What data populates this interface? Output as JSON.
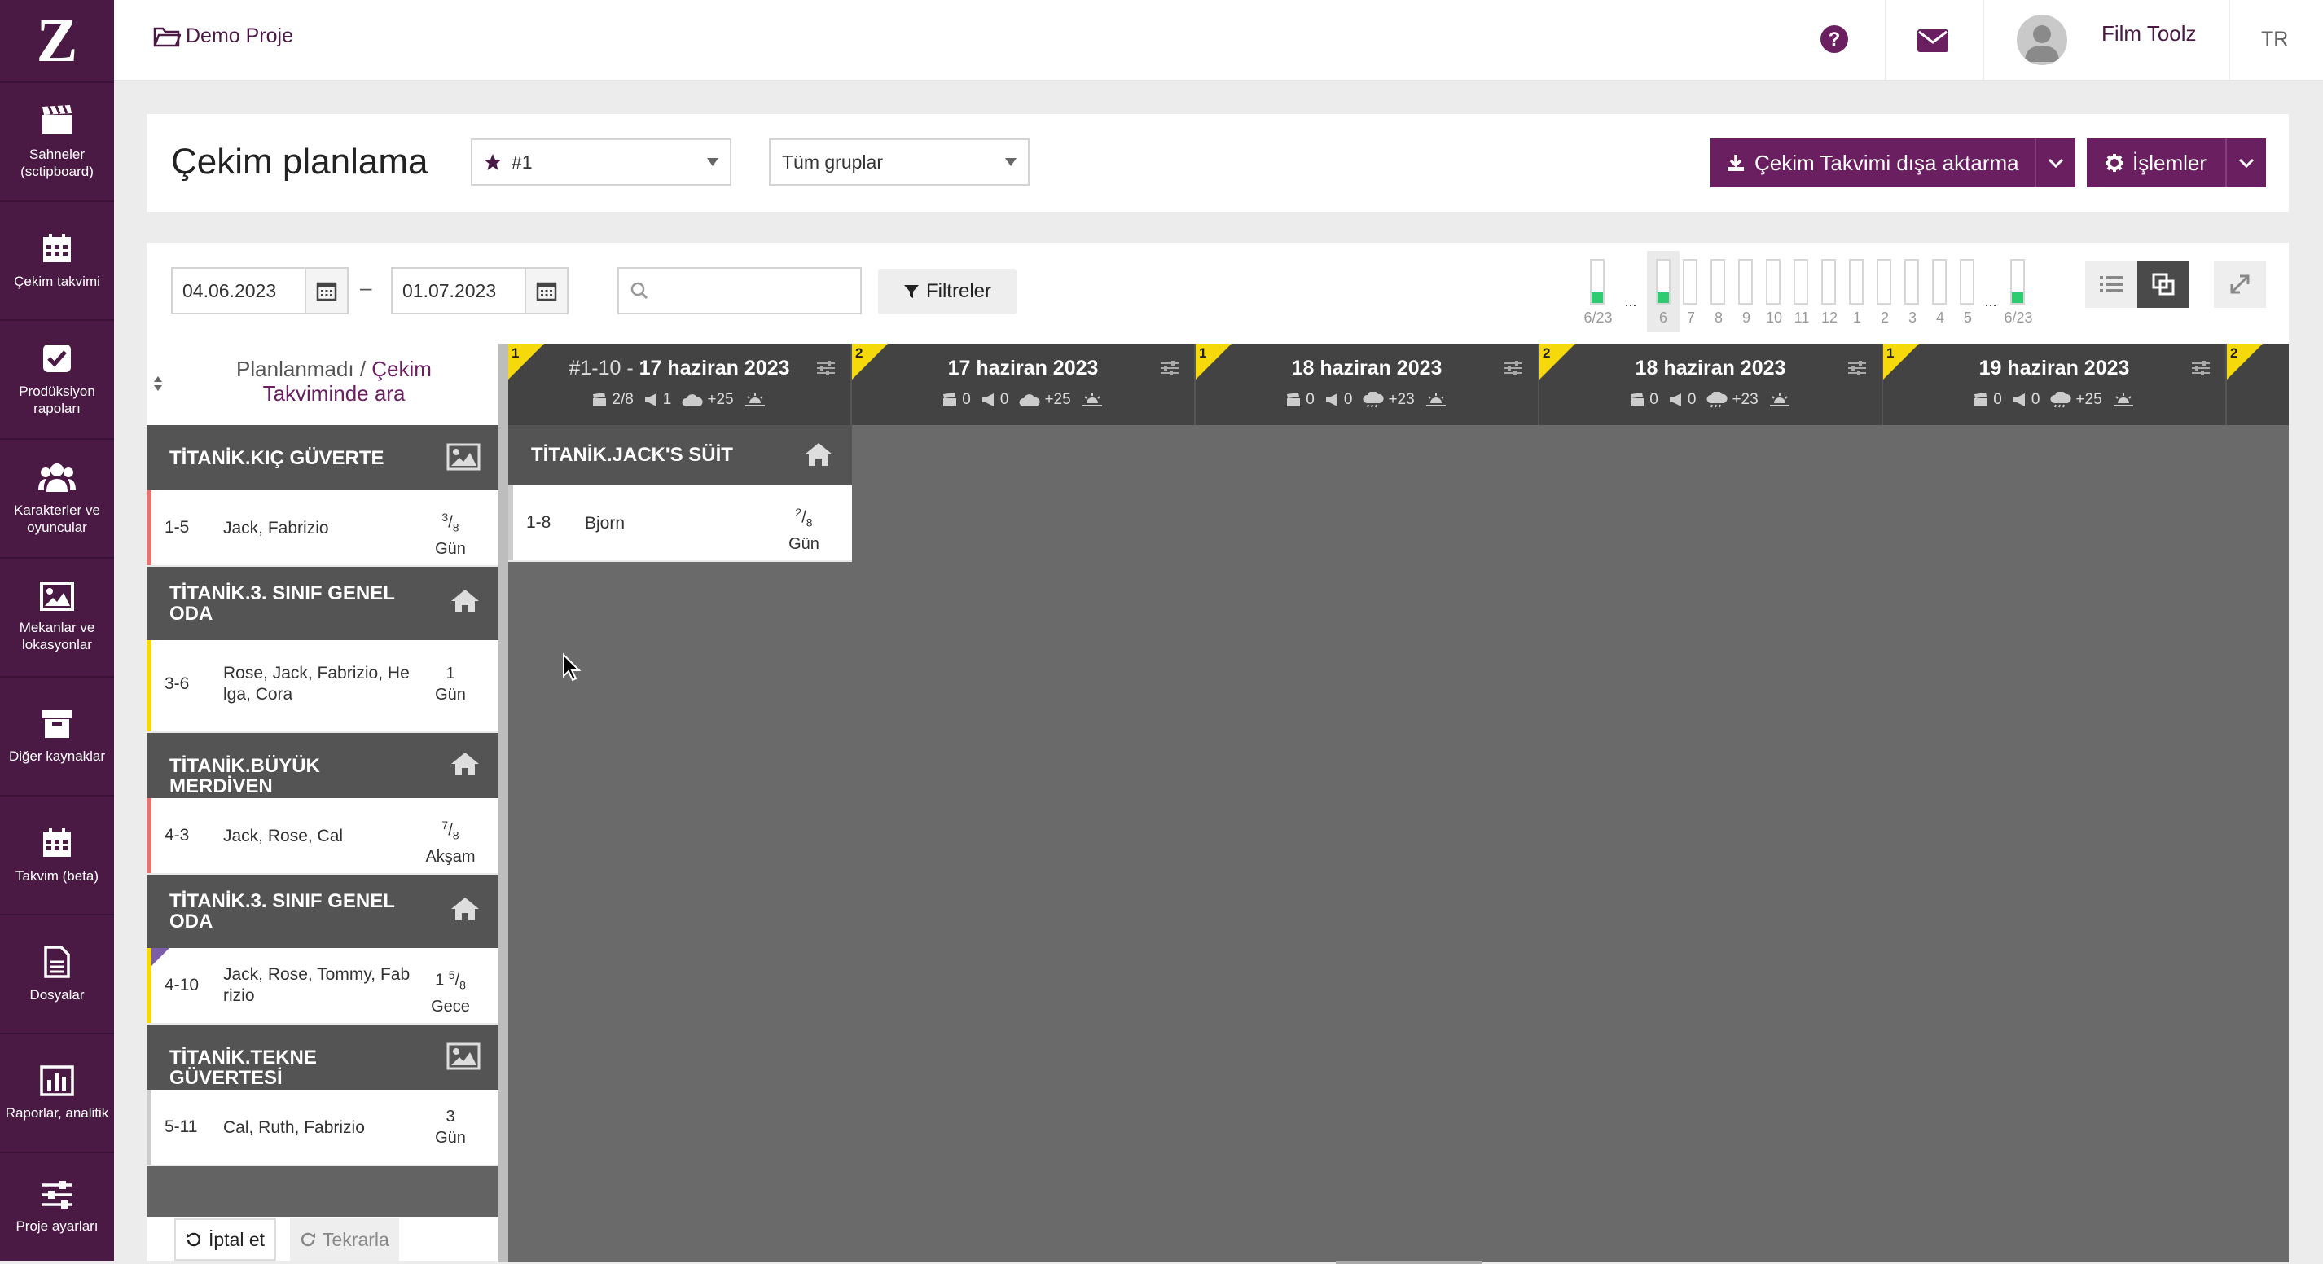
{
  "app": {
    "logo": "Z"
  },
  "sidebar": {
    "items": [
      {
        "label": "Sahneler\n(sctipboard)",
        "icon": "clapperboard-icon"
      },
      {
        "label": "Çekim takvimi",
        "icon": "calendar-icon"
      },
      {
        "label": "Prodüksiyon\nrapoları",
        "icon": "checkbox-icon"
      },
      {
        "label": "Karakterler ve\noyuncular",
        "icon": "users-icon"
      },
      {
        "label": "Mekanlar ve\nlokasyonlar",
        "icon": "image-icon"
      },
      {
        "label": "Diğer kaynaklar",
        "icon": "archive-icon"
      },
      {
        "label": "Takvim (beta)",
        "icon": "calendar-icon"
      },
      {
        "label": "Dosyalar",
        "icon": "document-icon"
      },
      {
        "label": "Raporlar, analitik",
        "icon": "bar-chart-icon"
      },
      {
        "label": "Proje ayarları",
        "icon": "sliders-icon"
      }
    ]
  },
  "topbar": {
    "project": "Demo Proje",
    "user_name": "Film Toolz",
    "language": "TR"
  },
  "header": {
    "title": "Çekim planlama",
    "schedule_select": "#1",
    "group_select": "Tüm gruplar",
    "export_button": "Çekim Takvimi dışa aktarma",
    "actions_button": "İşlemler"
  },
  "toolbar": {
    "date_from": "04.06.2023",
    "date_separator": "–",
    "date_to": "01.07.2023",
    "search_placeholder": "",
    "filter_button": "Filtreler"
  },
  "day_strip": {
    "days": [
      {
        "label": "6/23",
        "fill": 0.25
      },
      {
        "label": "...",
        "fill": null
      },
      {
        "label": "6",
        "fill": 0.25,
        "selected": true
      },
      {
        "label": "7",
        "fill": 0
      },
      {
        "label": "8",
        "fill": 0
      },
      {
        "label": "9",
        "fill": 0
      },
      {
        "label": "10",
        "fill": 0
      },
      {
        "label": "11",
        "fill": 0
      },
      {
        "label": "12",
        "fill": 0
      },
      {
        "label": "1",
        "fill": 0
      },
      {
        "label": "2",
        "fill": 0
      },
      {
        "label": "3",
        "fill": 0
      },
      {
        "label": "4",
        "fill": 0
      },
      {
        "label": "5",
        "fill": 0
      },
      {
        "label": "...",
        "fill": null
      },
      {
        "label": "6/23",
        "fill": 0.25
      }
    ]
  },
  "unplanned": {
    "title_part1": "Planlanmadı",
    "title_sep": " / ",
    "title_link": "Çekim Takviminde ara",
    "groups": [
      {
        "location": "TİTANİK.KIÇ GÜVERTE",
        "icon": "image-icon",
        "scene": {
          "num": "1-5",
          "chars": "Jack, Fabrizio",
          "len_num": "3",
          "len_den": "8",
          "len_whole": "",
          "time": "Gün",
          "stripe": "#e57373"
        }
      },
      {
        "location": "TİTANİK.3. SINIF GENEL ODA",
        "icon": "home-icon",
        "scene": {
          "num": "3-6",
          "chars": "Rose, Jack, Fabrizio, Helga, Cora",
          "len_num": "",
          "len_den": "",
          "len_whole": "1",
          "time": "Gün",
          "stripe": "#f5d90a"
        }
      },
      {
        "location": "TİTANİK.BÜYÜK MERDİVEN",
        "icon": "home-icon",
        "scene": {
          "num": "4-3",
          "chars": "Jack, Rose, Cal",
          "len_num": "7",
          "len_den": "8",
          "len_whole": "",
          "time": "Akşam",
          "stripe": "#e57373"
        }
      },
      {
        "location": "TİTANİK.3. SINIF GENEL ODA",
        "icon": "home-icon",
        "scene": {
          "num": "4-10",
          "chars": "Jack, Rose, Tommy, Fabrizio",
          "len_num": "5",
          "len_den": "8",
          "len_whole": "1 ",
          "time": "Gece",
          "stripe": "#f5d90a"
        }
      },
      {
        "location": "TİTANİK.TEKNE GÜVERTESİ",
        "icon": "image-icon",
        "scene": {
          "num": "5-11",
          "chars": "Cal, Ruth, Fabrizio",
          "len_num": "",
          "len_den": "",
          "len_whole": "3",
          "time": "Gün",
          "stripe": "#cccccc"
        }
      }
    ],
    "cancel_button": "İptal et",
    "redo_button": "Tekrarla"
  },
  "board": {
    "days": [
      {
        "badge": "1",
        "prefix": "#1-10 - ",
        "date": "17 haziran 2023",
        "scenes": "2/8",
        "pages": "1",
        "weather": "+25"
      },
      {
        "badge": "2",
        "prefix": "",
        "date": "17 haziran 2023",
        "scenes": "0",
        "pages": "0",
        "weather": "+25"
      },
      {
        "badge": "1",
        "prefix": "",
        "date": "18 haziran 2023",
        "scenes": "0",
        "pages": "0",
        "weather": "+23"
      },
      {
        "badge": "2",
        "prefix": "",
        "date": "18 haziran 2023",
        "scenes": "0",
        "pages": "0",
        "weather": "+23"
      },
      {
        "badge": "1",
        "prefix": "",
        "date": "19 haziran 2023",
        "scenes": "0",
        "pages": "0",
        "weather": "+25"
      },
      {
        "badge": "2",
        "prefix": "",
        "date": "",
        "scenes": "",
        "pages": "",
        "weather": ""
      }
    ],
    "planned_group": {
      "location": "TİTANİK.JACK'S SÜİT",
      "scene": {
        "num": "1-8",
        "chars": "Bjorn",
        "len_num": "2",
        "len_den": "8",
        "time": "Gün"
      }
    }
  },
  "colors": {
    "brand": "#6a1f60",
    "sidebar": "#4a1a44",
    "accent_yellow": "#f5d90a",
    "fill_green": "#2ecc71"
  }
}
